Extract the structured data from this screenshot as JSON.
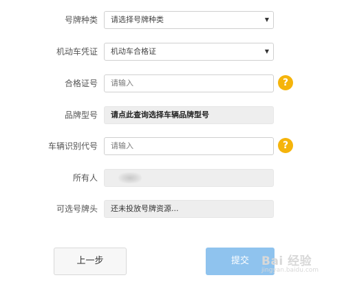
{
  "form": {
    "plate_type": {
      "label": "号牌种类",
      "value": "请选择号牌种类"
    },
    "vehicle_cert": {
      "label": "机动车凭证",
      "value": "机动车合格证"
    },
    "cert_no": {
      "label": "合格证号",
      "placeholder": "请输入",
      "help": "?"
    },
    "brand_model": {
      "label": "品牌型号",
      "value": "请点此查询选择车辆品牌型号"
    },
    "vin": {
      "label": "车辆识别代号",
      "placeholder": "请输入",
      "help": "?"
    },
    "owner": {
      "label": "所有人"
    },
    "optional_plate": {
      "label": "可选号牌头",
      "value": "还未投放号牌资源..."
    }
  },
  "buttons": {
    "back": "上一步",
    "submit": "提交"
  },
  "watermark": {
    "brand": "Bai 经验",
    "url": "jingyan.baidu.com"
  },
  "colors": {
    "help_badge": "#f5b40b",
    "submit_button": "#8fc3ee"
  }
}
